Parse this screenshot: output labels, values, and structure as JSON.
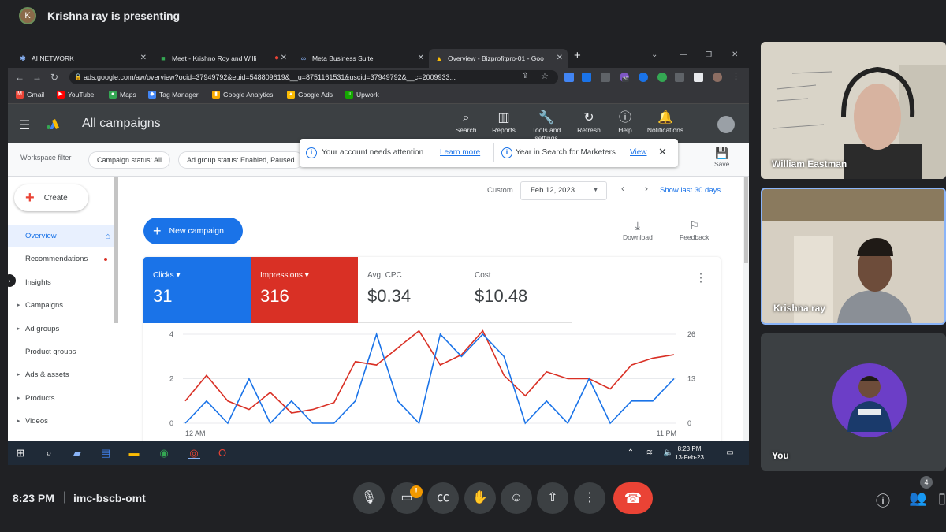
{
  "meet": {
    "presenting_text": "Krishna ray is presenting",
    "time": "8:23 PM",
    "separator": "|",
    "meeting_code": "imc-bscb-omt",
    "participant_count": "4",
    "participants": [
      {
        "name": "William Eastman"
      },
      {
        "name": "Krishna ray"
      },
      {
        "name": "You"
      }
    ]
  },
  "browser": {
    "tabs": [
      {
        "label": "AI NETWORK"
      },
      {
        "label": "Meet - Krishno Roy and Willi"
      },
      {
        "label": "Meta Business Suite"
      },
      {
        "label": "Overview - Bizprofitpro-01 - Goo"
      }
    ],
    "new_tab": "+",
    "url": "ads.google.com/aw/overview?ocid=37949792&euid=548809619&__u=8751161531&uscid=37949792&__c=2009933...",
    "extension_badge": "20",
    "bookmarks": [
      "Gmail",
      "YouTube",
      "Maps",
      "Tag Manager",
      "Google Analytics",
      "Google Ads",
      "Upwork"
    ]
  },
  "ads": {
    "page_title": "All campaigns",
    "header_buttons": [
      "Search",
      "Reports",
      "Tools and settings",
      "Refresh",
      "Help",
      "Notifications"
    ],
    "workspace_filter": "Workspace filter",
    "chips": [
      "Campaign status: All",
      "Ad group status: Enabled, Paused"
    ],
    "save_label": "Save",
    "attention": {
      "message1": "Your account needs attention",
      "link1": "Learn more",
      "message2": "Year in Search for Marketers",
      "link2": "View"
    },
    "create_label": "Create",
    "sidebar": [
      {
        "label": "Overview"
      },
      {
        "label": "Recommendations"
      },
      {
        "label": "Insights"
      },
      {
        "label": "Campaigns"
      },
      {
        "label": "Ad groups"
      },
      {
        "label": "Product groups"
      },
      {
        "label": "Ads & assets"
      },
      {
        "label": "Products"
      },
      {
        "label": "Videos"
      }
    ],
    "date": {
      "mode": "Custom",
      "value": "Feb 12, 2023",
      "show_last": "Show last 30 days"
    },
    "new_campaign": "New campaign",
    "download": "Download",
    "feedback": "Feedback",
    "metrics": [
      {
        "label": "Clicks",
        "value": "31"
      },
      {
        "label": "Impressions",
        "value": "316"
      },
      {
        "label": "Avg. CPC",
        "value": "$0.34"
      },
      {
        "label": "Cost",
        "value": "$10.48"
      }
    ]
  },
  "chart_data": {
    "type": "line",
    "x_start_label": "12 AM",
    "x_end_label": "11 PM",
    "left_ticks": [
      "4",
      "2",
      "0"
    ],
    "right_ticks": [
      "26",
      "13",
      "0"
    ],
    "ylim_left": [
      0,
      4
    ],
    "ylim_right": [
      0,
      26
    ],
    "series": [
      {
        "name": "Clicks",
        "color": "#1a73e8",
        "axis": "left",
        "values": [
          0,
          1,
          0,
          2,
          0,
          1,
          0,
          0,
          1,
          4,
          1,
          0,
          4,
          3,
          4,
          3,
          0,
          1,
          0,
          2,
          0,
          1,
          1,
          2
        ]
      },
      {
        "name": "Impressions",
        "color": "#d93025",
        "axis": "right",
        "values": [
          6.5,
          14,
          6.5,
          4,
          9,
          3,
          4,
          6,
          18,
          17,
          22,
          27,
          17,
          20,
          27,
          14,
          8,
          15,
          13,
          13,
          10,
          17,
          19,
          20
        ]
      }
    ]
  },
  "taskbar": {
    "time": "8:23 PM",
    "date": "13-Feb-23"
  },
  "colors": {
    "clicks": "#1a73e8",
    "impressions": "#d93025",
    "end_call": "#ea4335",
    "accent": "#1a73e8"
  }
}
